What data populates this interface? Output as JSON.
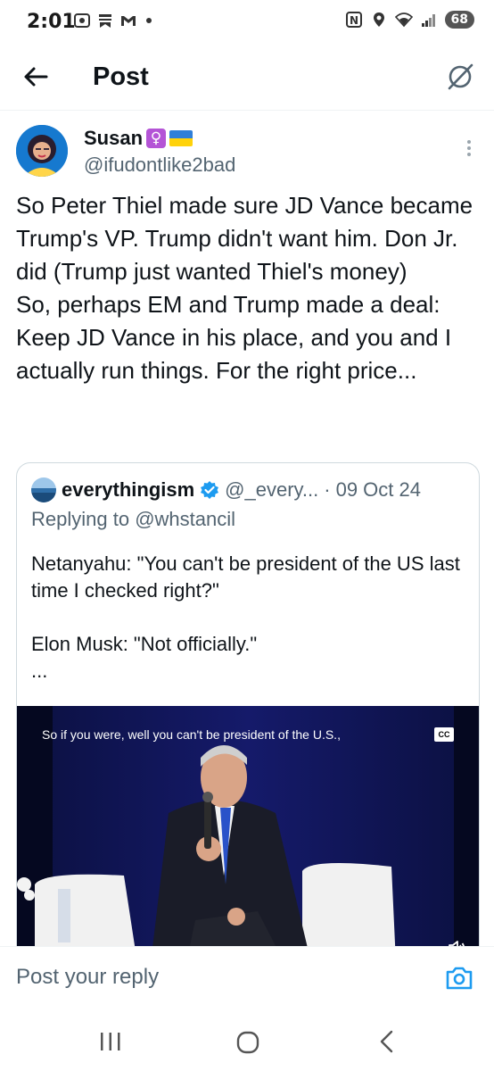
{
  "status_bar": {
    "time": "2:01",
    "battery": "68"
  },
  "header": {
    "title": "Post",
    "back_icon": "arrow-left-icon",
    "grok_icon": "grok-icon"
  },
  "post": {
    "author_name": "Susan",
    "author_handle": "@ifudontlike2bad",
    "name_emoji": "♀",
    "text": "So Peter Thiel made sure JD Vance became Trump's VP. Trump didn't want him. Don Jr. did (Trump just wanted Thiel's money)\nSo, perhaps EM and Trump made a deal: Keep JD Vance in his place, and you and I actually run things. For the right price...",
    "quote": {
      "author_name": "everythingism",
      "author_handle": "@_every...",
      "separator": "·",
      "date": "09 Oct 24",
      "replying_to_prefix": "Replying to",
      "replying_to_handle": "@whstancil",
      "text": "Netanyahu: \"You can't be president of the US last time I checked right?\"\n\nElon Musk: \"Not officially.\"\n...",
      "video_caption": "So if you were, well you can't be president of the U.S.,",
      "cc_label": "CC"
    }
  },
  "reply_bar": {
    "placeholder": "Post your reply"
  },
  "colors": {
    "text_primary": "#0f1419",
    "text_secondary": "#536471",
    "accent": "#1d9bf0",
    "border": "#cfd9de"
  }
}
